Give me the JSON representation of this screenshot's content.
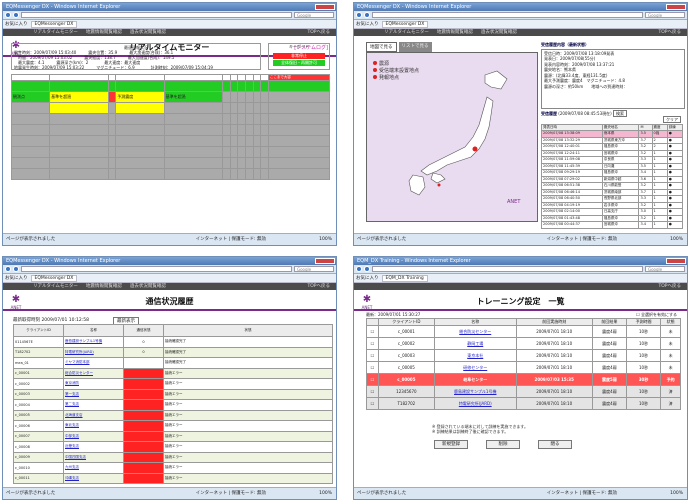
{
  "browser": {
    "favorites": "お気に入り",
    "search_engine": "Google",
    "status_done": "ページが表示されました",
    "zone": "インターネット | 保護モード: 無効",
    "zoom": "100%"
  },
  "w1": {
    "window_title": "EQMessenger DX - Windows Internet Explorer",
    "tab": "EQMessenger DX",
    "menu": [
      "リアルタイムモニター",
      "地震情報閲覧確認",
      "過去状況閲覧確認"
    ],
    "back": "TOPへ戻る",
    "logo": "ANET",
    "title": "リアルタイムモニター",
    "system_log": "[システムログ]",
    "info_header": "最速速報状況",
    "info_lines": [
      "発生時刻：2009/07/09 15:03:40　　　震央位置：35.9　　　最大加速度(合成)：36.1",
      "　時間：2009/07/09 15:03:02　　　震央経度：138.7　　　最大加速度(合成)：149.5",
      "　最大震度：4.1　　　震源深さ(km)：2　　　　最大速度：最大速度",
      "地震発生時刻：2009/07/09 15:03:22　　　マグニチュード：6.9　　　　計測時刻：2009/07/09 15:04:19"
    ],
    "side_header": "キーボード",
    "side_btn1": "非常停止",
    "side_btn2": "全体復旧・再開許可",
    "grid_headers": [
      "",
      "",
      "",
      "",
      "",
      "",
      "",
      "",
      "",
      "",
      "",
      "ここまで大容"
    ],
    "row_cells": [
      "観測点",
      "基準を超過",
      "",
      "予測震度",
      "基準を超過",
      "",
      "",
      "",
      "",
      "",
      "",
      ""
    ]
  },
  "w2": {
    "window_title": "EQMessenger DX - Windows Internet Explorer",
    "tab": "EQMessenger DX",
    "menu": [
      "リアルタイムモニター",
      "地震情報閲覧確認",
      "過去状況閲覧確認"
    ],
    "back": "TOPへ戻る",
    "map_tab": "地図で見る",
    "list_tab": "リストで見る",
    "legend": [
      "震源",
      "受信端末設置地点",
      "発報地点"
    ],
    "logo": "ANET",
    "detail_title": "受信履歴内容（最新状態）",
    "detail_lines": [
      "受信日時：2009/07/08 13:18:09発表",
      "発表日：2009/07/08(55分)",
      "発表内容時刻：2009/07/08 13:37:21",
      "震央地名：熊本県",
      "震源：(北緯33.4度、東経131.5度)",
      "最大予測震度：震度4　マグニチュード：4.8",
      "震源の深さ：約50km　　地域への到達時刻："
    ],
    "history_title": "受信履歴",
    "history_date": "(2009/07/08 08:45:53現在)",
    "history_btn": "検索",
    "clear_btn": "クリア",
    "list_headers": [
      "発表日時",
      "震央地名",
      "M",
      "震度",
      "訓練"
    ],
    "list_rows": [
      [
        "2009/07/08 13:38:09",
        "熊本県",
        "3.5",
        "0強"
      ],
      [
        "2009/07/08 13:32:29",
        "茨城県東方沖",
        "3.7",
        "2"
      ],
      [
        "2009/07/08 12:40:01",
        "福島県沖",
        "3.2",
        "2"
      ],
      [
        "2009/07/08 12:24:11",
        "宮城県沖",
        "3.2",
        "1"
      ],
      [
        "2009/07/08 11:59:08",
        "奈良県",
        "3.3",
        "1"
      ],
      [
        "2009/07/08 11:45:39",
        "日向灘",
        "3.5",
        "1"
      ],
      [
        "2009/07/08 09:29:19",
        "福島県沖",
        "3.4",
        "1"
      ],
      [
        "2009/07/08 07:29:02",
        "新潟県中越",
        "3.6",
        "1"
      ],
      [
        "2009/07/08 06:51:38",
        "石川県能登",
        "3.2",
        "1"
      ],
      [
        "2009/07/08 06:46:14",
        "茨城県南部",
        "3.7",
        "1"
      ],
      [
        "2009/07/08 06:40:50",
        "長野県北部",
        "3.3",
        "1"
      ],
      [
        "2009/07/08 04:19:19",
        "岩手県沖",
        "3.2",
        "1"
      ],
      [
        "2009/07/08 02:14:00",
        "日高支庁",
        "3.0",
        "1"
      ],
      [
        "2009/07/08 01:43:48",
        "福島県沖",
        "3.2",
        "1"
      ],
      [
        "2009/07/08 00:44:37",
        "宮城県沖",
        "3.4",
        "1"
      ]
    ]
  },
  "w3": {
    "window_title": "EQMessenger DX - Windows Internet Explorer",
    "tab": "EQMessenger DX",
    "menu": [
      "リアルタイムモニター",
      "地震情報閲覧確認",
      "過去状況閲覧確認"
    ],
    "back": "TOPへ戻る",
    "logo": "ANET",
    "title": "通信状況履歴",
    "last_update": "最新取得時刻",
    "update_time": "2009/07/01 10:12:58",
    "update_btn": "最新表示",
    "headers": [
      "クライアントID",
      "名称",
      "通信状態",
      "状態"
    ],
    "rows": [
      [
        "0114567E",
        "鹿島建設サンプル1号機",
        "0",
        "接続確認完了"
      ],
      [
        "T182702",
        "特電研究所(JARD)",
        "0",
        "接続確認完了"
      ],
      [
        "mea_01",
        "ミヤマ消防本部",
        "",
        "接続確認完了"
      ],
      [
        "c_00001",
        "総合防災センター",
        "",
        "接続エラー"
      ],
      [
        "c_00002",
        "東京消防",
        "",
        "接続エラー"
      ],
      [
        "c_00003",
        "第一支店",
        "",
        "接続エラー"
      ],
      [
        "c_00004",
        "第二支店",
        "",
        "接続エラー"
      ],
      [
        "c_00005",
        "北海道支店",
        "",
        "接続エラー"
      ],
      [
        "c_00006",
        "東北支店",
        "",
        "接続エラー"
      ],
      [
        "c_00007",
        "中部支店",
        "",
        "接続エラー"
      ],
      [
        "c_00008",
        "近畿支店",
        "",
        "接続エラー"
      ],
      [
        "c_00009",
        "中国四国支店",
        "",
        "接続エラー"
      ],
      [
        "c_00010",
        "九州支店",
        "",
        "接続エラー"
      ],
      [
        "c_00011",
        "沖縄支店",
        "",
        "接続エラー"
      ]
    ]
  },
  "w4": {
    "window_title": "EQM_DX Training - Windows Internet Explorer",
    "tab": "EQM_DX Training",
    "back": "TOPへ戻る",
    "logo": "ANET",
    "title": "トレーニング設定　一覧",
    "check_label": "最新：2009/07/01 15:30:27",
    "check_all": "全選択を有効にする",
    "headers": [
      "",
      "クライアントID",
      "名称",
      "前回実施時刻",
      "前回結果",
      "予測時間",
      "状態"
    ],
    "rows": [
      [
        "",
        "c_00001",
        "総合防災センター",
        "2009/07/01 18:10",
        "震度4弱",
        "10秒",
        "未"
      ],
      [
        "",
        "c_00002",
        "静岡工場",
        "2009/07/01 18:10",
        "震度4弱",
        "10秒",
        "未"
      ],
      [
        "",
        "c_00003",
        "東京本社",
        "2009/07/01 18:10",
        "震度4弱",
        "10秒",
        "未"
      ],
      [
        "",
        "c_00005",
        "研修センター",
        "2009/07/01 18:10",
        "震度4弱",
        "10秒",
        "未"
      ],
      [
        "",
        "c_00005",
        "岐阜センター",
        "2009/07/03 15:35",
        "震度5弱",
        "30秒",
        "予約"
      ],
      [
        "",
        "12345670",
        "鹿島建設サンプル1号機",
        "2009/07/01 18:10",
        "震度4弱",
        "10秒",
        "済"
      ],
      [
        "",
        "T182702",
        "特電研究所(JARD)",
        "2009/07/01 18:10",
        "震度4弱",
        "10秒",
        "済"
      ]
    ],
    "notes": [
      "※ 登録されている端末に対して訓練を実施できます。",
      "※ 訓練結果は訓練終了後に確認できます。"
    ],
    "btn_new": "新規登録",
    "btn_delete": "削除",
    "btn_close": "閉る"
  }
}
